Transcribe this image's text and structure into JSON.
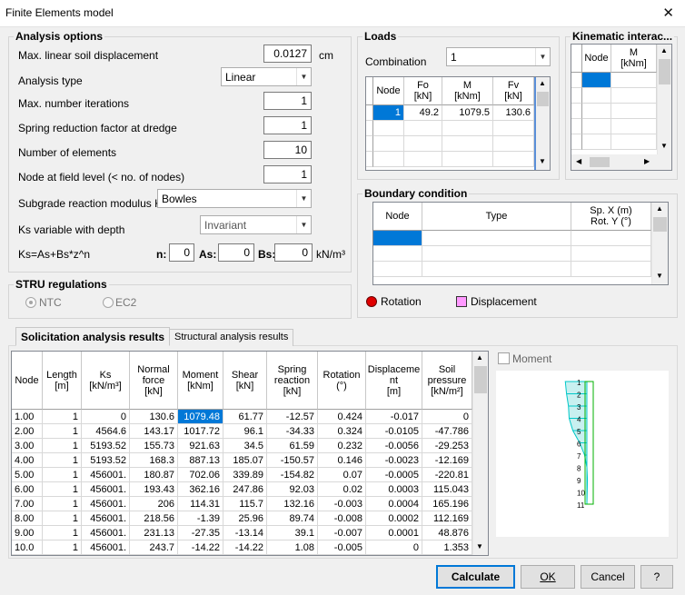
{
  "window": {
    "title": "Finite Elements model",
    "close": "✕"
  },
  "analysis": {
    "title": "Analysis options",
    "max_disp_label": "Max. linear soil displacement",
    "max_disp_value": "0.0127",
    "max_disp_unit": "cm",
    "type_label": "Analysis type",
    "type_value": "Linear",
    "iter_label": "Max. number iterations",
    "iter_value": "1",
    "spring_label": "Spring reduction factor at dredge",
    "spring_value": "1",
    "elements_label": "Number of elements",
    "elements_value": "10",
    "node_field_label": "Node at field level (< no. of nodes)",
    "node_field_value": "1",
    "ks_label": "Subgrade reaction modulus Ks",
    "ks_value": "Bowles",
    "ks_var_label": "Ks variable with depth",
    "ks_var_value": "Invariant",
    "formula_label": "Ks=As+Bs*z^n",
    "n_label": "n:",
    "n_value": "0",
    "as_label": "As:",
    "as_value": "0",
    "bs_label": "Bs:",
    "bs_value": "0",
    "bs_unit": "kN/m³"
  },
  "stru": {
    "title": "STRU regulations",
    "opt1": "NTC",
    "opt2": "EC2"
  },
  "loads": {
    "title": "Loads",
    "combination_label": "Combination",
    "combination_value": "1",
    "headers": [
      "Node",
      "Fo\n[kN]",
      "M\n[kNm]",
      "Fv\n[kN]"
    ],
    "rows": [
      [
        "1",
        "49.2",
        "1079.5",
        "130.6"
      ]
    ]
  },
  "kin": {
    "title": "Kinematic interac...",
    "headers": [
      "Node",
      "M\n[kNm]"
    ]
  },
  "boundary": {
    "title": "Boundary condition",
    "headers": [
      "Node",
      "Type",
      "Sp. X (m)\nRot. Y (°)"
    ],
    "legend_rotation": "Rotation",
    "legend_displacement": "Displacement"
  },
  "tabs": {
    "tab1": "Solicitation analysis results",
    "tab2": "Structural analysis results"
  },
  "results": {
    "headers": [
      "Node",
      "Length\n[m]",
      "Ks\n[kN/m³]",
      "Normal\nforce\n[kN]",
      "Moment\n[kNm]",
      "Shear\n[kN]",
      "Spring\nreaction\n[kN]",
      "Rotation\n(°)",
      "Displaceme\nnt\n[m]",
      "Soil\npressure\n[kN/m²]"
    ],
    "rows": [
      [
        "1.00",
        "1",
        "0",
        "130.6",
        "1079.48",
        "61.77",
        "-12.57",
        "0.424",
        "-0.017",
        "0"
      ],
      [
        "2.00",
        "1",
        "4564.6",
        "143.17",
        "1017.72",
        "96.1",
        "-34.33",
        "0.324",
        "-0.0105",
        "-47.786"
      ],
      [
        "3.00",
        "1",
        "5193.52",
        "155.73",
        "921.63",
        "34.5",
        "61.59",
        "0.232",
        "-0.0056",
        "-29.253"
      ],
      [
        "4.00",
        "1",
        "5193.52",
        "168.3",
        "887.13",
        "185.07",
        "-150.57",
        "0.146",
        "-0.0023",
        "-12.169"
      ],
      [
        "5.00",
        "1",
        "456001.",
        "180.87",
        "702.06",
        "339.89",
        "-154.82",
        "0.07",
        "-0.0005",
        "-220.81"
      ],
      [
        "6.00",
        "1",
        "456001.",
        "193.43",
        "362.16",
        "247.86",
        "92.03",
        "0.02",
        "0.0003",
        "115.043"
      ],
      [
        "7.00",
        "1",
        "456001.",
        "206",
        "114.31",
        "115.7",
        "132.16",
        "-0.003",
        "0.0004",
        "165.196"
      ],
      [
        "8.00",
        "1",
        "456001.",
        "218.56",
        "-1.39",
        "25.96",
        "89.74",
        "-0.008",
        "0.0002",
        "112.169"
      ],
      [
        "9.00",
        "1",
        "456001.",
        "231.13",
        "-27.35",
        "-13.14",
        "39.1",
        "-0.007",
        "0.0001",
        "48.876"
      ],
      [
        "10.0",
        "1",
        "456001.",
        "243.7",
        "-14.22",
        "-14.22",
        "1.08",
        "-0.005",
        "0",
        "1.353"
      ]
    ]
  },
  "moment_check_label": "Moment",
  "diagram_nodes": [
    "1",
    "2",
    "3",
    "4",
    "5",
    "6",
    "7",
    "8",
    "9",
    "10",
    "11"
  ],
  "buttons": {
    "calculate": "Calculate",
    "ok": "OK",
    "cancel": "Cancel",
    "help": "?"
  },
  "colors": {
    "selection": "#0078d7",
    "rotation": "#e00000",
    "displacement": "#ff99ff",
    "diagram_fill": "#c8f0f0",
    "diagram_line": "#00c8c8",
    "pile_line": "#00b000"
  }
}
